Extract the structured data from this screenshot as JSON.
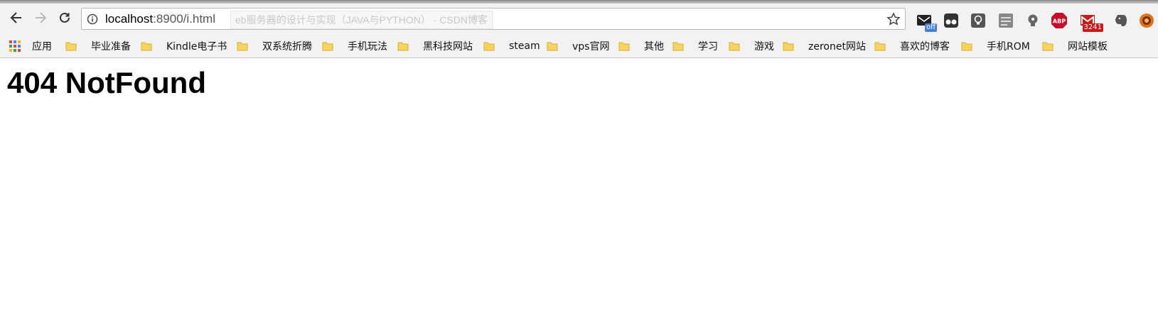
{
  "browser": {
    "address_bar": {
      "host": "localhost",
      "path": ":8900/i.html",
      "suggestion_ghost": "eb服务器的设计与实现（JAVA与PYTHON） - CSDN博客"
    },
    "extensions": [
      {
        "name": "mail-extension-icon",
        "badge": "off",
        "badge_color": "#4a7fd6"
      },
      {
        "name": "tampermonkey-icon"
      },
      {
        "name": "lightbulb-extension-icon"
      },
      {
        "name": "page-extension-icon"
      },
      {
        "name": "bulb-icon"
      },
      {
        "name": "adblock-plus-icon",
        "label": "ABP"
      },
      {
        "name": "gmail-notifier-icon",
        "badge": "3241",
        "badge_color": "#c81a1a"
      },
      {
        "name": "evernote-icon"
      },
      {
        "name": "ghostery-icon"
      }
    ],
    "bookmarks": [
      {
        "label": "应用",
        "icon": "apps-grid-icon"
      },
      {
        "label": "毕业准备",
        "icon": "folder-icon"
      },
      {
        "label": "Kindle电子书",
        "icon": "folder-icon"
      },
      {
        "label": "双系统折腾",
        "icon": "folder-icon"
      },
      {
        "label": "手机玩法",
        "icon": "folder-icon"
      },
      {
        "label": "黑科技网站",
        "icon": "folder-icon"
      },
      {
        "label": "steam",
        "icon": "folder-icon"
      },
      {
        "label": "vps官网",
        "icon": "folder-icon"
      },
      {
        "label": "其他",
        "icon": "folder-icon"
      },
      {
        "label": "学习",
        "icon": "folder-icon"
      },
      {
        "label": "游戏",
        "icon": "folder-icon"
      },
      {
        "label": "zeronet网站",
        "icon": "folder-icon"
      },
      {
        "label": "喜欢的博客",
        "icon": "folder-icon"
      },
      {
        "label": "手机ROM",
        "icon": "folder-icon"
      },
      {
        "label": "网站模板",
        "icon": "folder-icon"
      }
    ]
  },
  "page": {
    "heading": "404 NotFound"
  },
  "colors": {
    "folder": "#f7d462",
    "chrome_bg": "#f2f2f2"
  }
}
